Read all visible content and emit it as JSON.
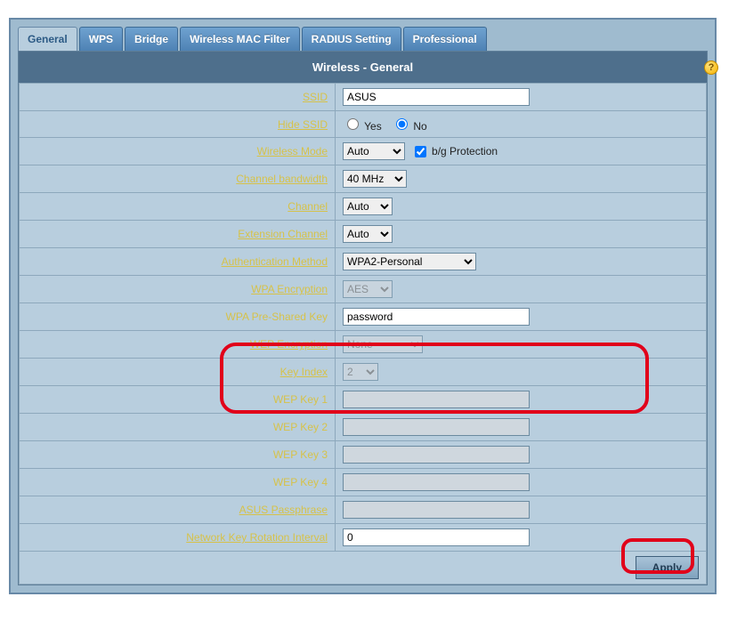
{
  "tabs": {
    "general": "General",
    "wps": "WPS",
    "bridge": "Bridge",
    "macfilter": "Wireless MAC Filter",
    "radius": "RADIUS Setting",
    "professional": "Professional"
  },
  "panel_title": "Wireless - General",
  "help_icon": "?",
  "labels": {
    "ssid": "SSID",
    "hide_ssid": "Hide SSID",
    "wireless_mode": "Wireless Mode",
    "channel_bw": "Channel bandwidth",
    "channel": "Channel",
    "ext_channel": "Extension Channel",
    "auth_method": "Authentication Method",
    "wpa_enc": "WPA Encryption",
    "wpa_psk": "WPA Pre-Shared Key",
    "wep_enc": "WEP Encryption",
    "key_index": "Key Index",
    "wep1": "WEP Key 1",
    "wep2": "WEP Key 2",
    "wep3": "WEP Key 3",
    "wep4": "WEP Key 4",
    "asus_pass": "ASUS Passphrase",
    "net_rot": "Network Key Rotation Interval",
    "yes": "Yes",
    "no": "No",
    "bg_prot": "b/g Protection"
  },
  "values": {
    "ssid": "ASUS",
    "hide_ssid": "no",
    "wireless_mode": "Auto",
    "bg_prot_checked": true,
    "channel_bw": "40 MHz",
    "channel": "Auto",
    "ext_channel": "Auto",
    "auth_method": "WPA2-Personal",
    "wpa_enc": "AES",
    "wpa_psk": "password",
    "wep_enc": "None",
    "key_index": "2",
    "wep1": "",
    "wep2": "",
    "wep3": "",
    "wep4": "",
    "asus_pass": "",
    "net_rot": "0"
  },
  "buttons": {
    "apply": "Apply"
  }
}
